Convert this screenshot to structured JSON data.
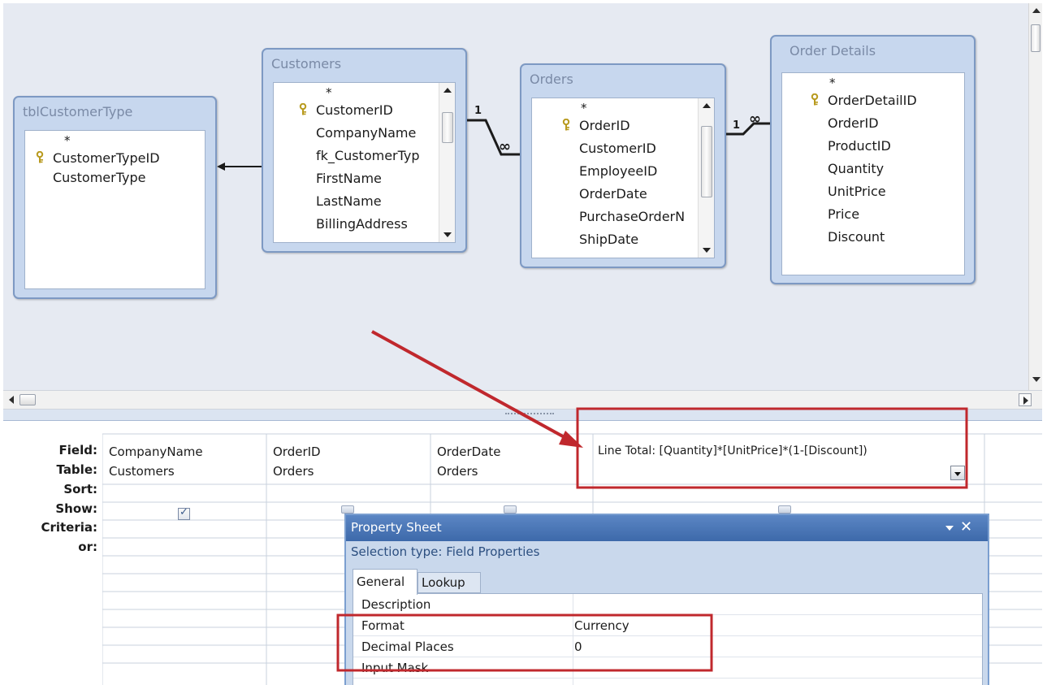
{
  "tables": [
    {
      "title": "tblCustomerType",
      "fields": [
        "*",
        "CustomerTypeID",
        "CustomerType"
      ],
      "key_field": "CustomerTypeID"
    },
    {
      "title": "Customers",
      "fields": [
        "*",
        "CustomerID",
        "CompanyName",
        "fk_CustomerTyp",
        "FirstName",
        "LastName",
        "BillingAddress"
      ],
      "key_field": "CustomerID"
    },
    {
      "title": "Orders",
      "fields": [
        "*",
        "OrderID",
        "CustomerID",
        "EmployeeID",
        "OrderDate",
        "PurchaseOrderN",
        "ShipDate"
      ],
      "key_field": "OrderID"
    },
    {
      "title": "Order Details",
      "fields": [
        "*",
        "OrderDetailID",
        "OrderID",
        "ProductID",
        "Quantity",
        "UnitPrice",
        "Price",
        "Discount"
      ],
      "key_field": "OrderDetailID"
    }
  ],
  "relationships": [
    {
      "one_label": "1",
      "many_label": "∞"
    },
    {
      "one_label": "1",
      "many_label": "∞"
    }
  ],
  "query_grid": {
    "row_labels": {
      "field": "Field:",
      "table": "Table:",
      "sort": "Sort:",
      "show": "Show:",
      "criteria": "Criteria:",
      "or": "or:"
    },
    "columns": [
      {
        "field": "CompanyName",
        "table": "Customers",
        "show": true
      },
      {
        "field": "OrderID",
        "table": "Orders",
        "show": true
      },
      {
        "field": "OrderDate",
        "table": "Orders",
        "show": true
      },
      {
        "field": "Line Total: [Quantity]*[UnitPrice]*(1-[Discount])",
        "table": "",
        "show": true
      }
    ]
  },
  "property_sheet": {
    "title": "Property Sheet",
    "selection_type": "Selection type:  Field Properties",
    "tabs": [
      "General",
      "Lookup"
    ],
    "active_tab": "General",
    "properties": [
      {
        "label": "Description",
        "value": ""
      },
      {
        "label": "Format",
        "value": "Currency"
      },
      {
        "label": "Decimal Places",
        "value": "0"
      },
      {
        "label": "Input Mask",
        "value": ""
      }
    ]
  },
  "colors": {
    "annotation_red": "#c0282d",
    "window_border": "#7d99c3",
    "titlebar_blue": "#4a76b8"
  },
  "icons": [
    "primary-key-icon",
    "scroll-up-arrow-icon",
    "scroll-down-arrow-icon",
    "dropdown-arrow-icon",
    "close-icon"
  ]
}
